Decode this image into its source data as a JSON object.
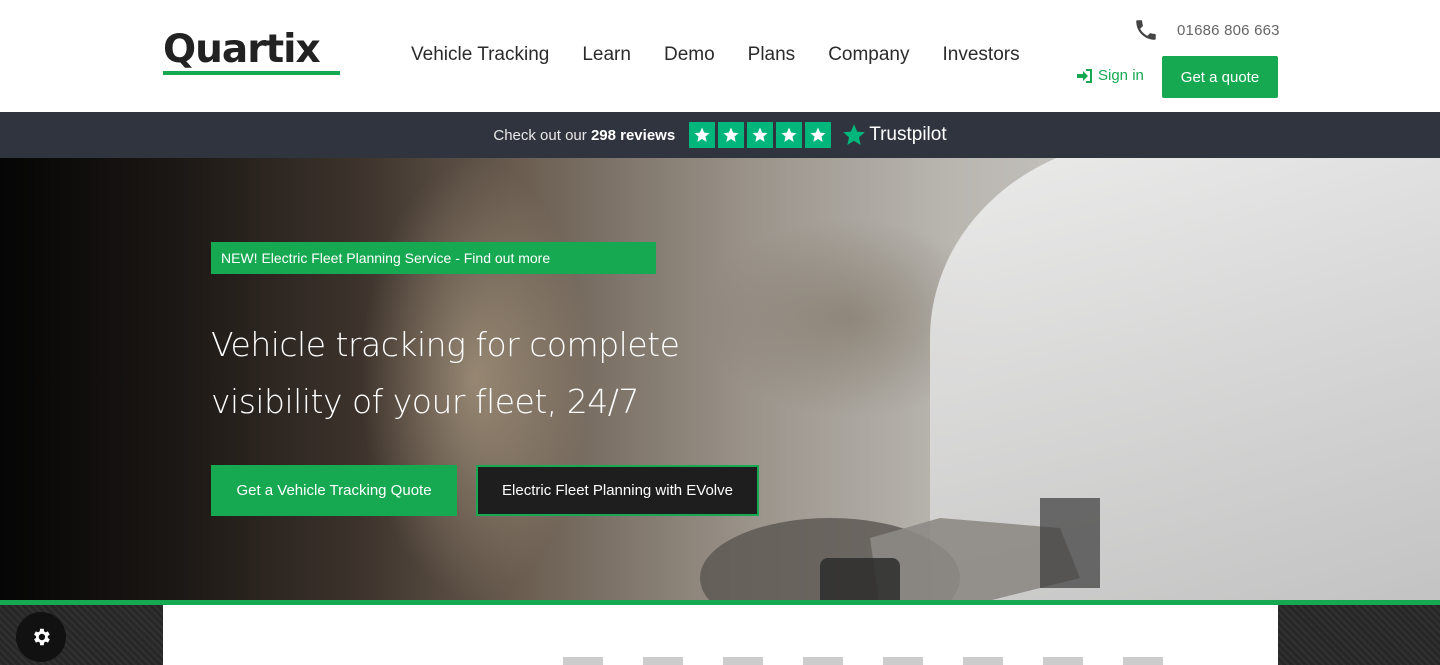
{
  "header": {
    "logo": "Quartix",
    "nav": [
      "Vehicle Tracking",
      "Learn",
      "Demo",
      "Plans",
      "Company",
      "Investors"
    ],
    "phone": "01686 806 663",
    "signin": "Sign in",
    "quote": "Get a quote"
  },
  "trustpilot": {
    "prefix": "Check out our",
    "count": "298 reviews",
    "brand": "Trustpilot",
    "rating_stars": 5
  },
  "hero": {
    "badge": "NEW! Electric Fleet Planning Service - Find out more",
    "title": "Vehicle tracking for complete visibility of your fleet, 24/7",
    "primary_button": "Get a Vehicle Tracking Quote",
    "secondary_button": "Electric Fleet Planning with EVolve"
  },
  "icons": {
    "phone": "phone-icon",
    "signin": "sign-in-icon",
    "star": "star-icon",
    "cookie": "gear-icon"
  },
  "colors": {
    "brand_green": "#17a852",
    "trustpilot_green": "#00b67a",
    "bar_dark": "#2f343f"
  }
}
